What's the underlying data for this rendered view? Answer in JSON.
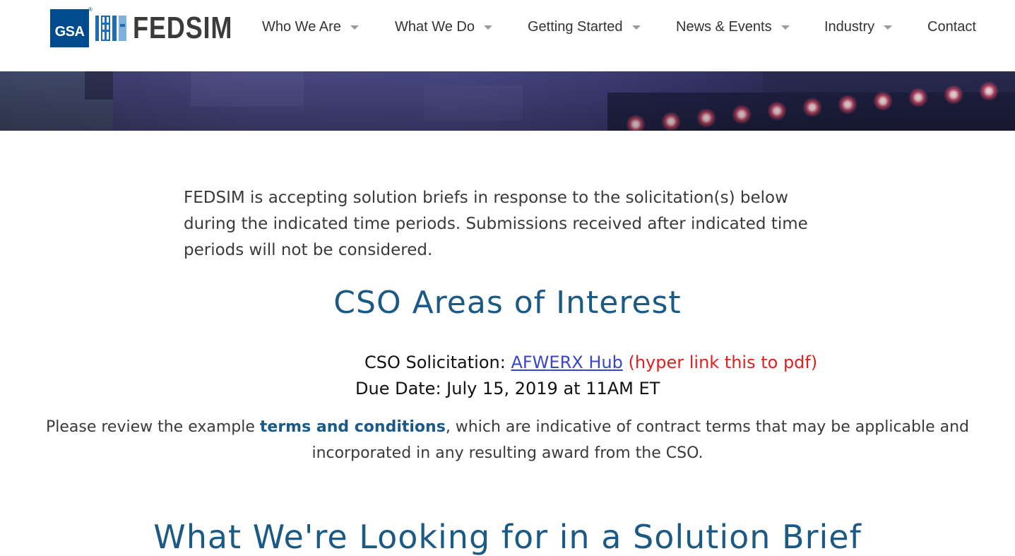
{
  "header": {
    "logo": {
      "gsa_text": "GSA",
      "registered_mark": "®",
      "brand_text": "FEDSIM"
    },
    "nav": [
      {
        "label": "Who We Are",
        "has_dropdown": true
      },
      {
        "label": "What We Do",
        "has_dropdown": true
      },
      {
        "label": "Getting Started",
        "has_dropdown": true
      },
      {
        "label": "News & Events",
        "has_dropdown": true
      },
      {
        "label": "Industry",
        "has_dropdown": true
      },
      {
        "label": "Contact",
        "has_dropdown": false
      }
    ]
  },
  "content": {
    "intro": "FEDSIM is accepting solution briefs in response to the solicitation(s) below during the indicated time periods. Submissions received after indicated time periods will not be considered.",
    "cso_heading": "CSO Areas of Interest",
    "solicitation": {
      "label": "CSO Solicitation:",
      "link_text": "AFWERX Hub",
      "note": "(hyper link this to pdf)"
    },
    "due_date": "Due Date: July 15, 2019 at 11AM ET",
    "terms": {
      "before": "Please review the example ",
      "link_text": "terms and conditions",
      "after": ", which are indicative of contract terms that may be applicable and incorporated in any resulting award from the CSO."
    },
    "next_heading": "What We're Looking for in a Solution Brief"
  },
  "colors": {
    "brand_blue": "#004b8d",
    "heading_blue": "#1a5a85",
    "link_blue": "#3a46c8",
    "note_red": "#e02020"
  }
}
